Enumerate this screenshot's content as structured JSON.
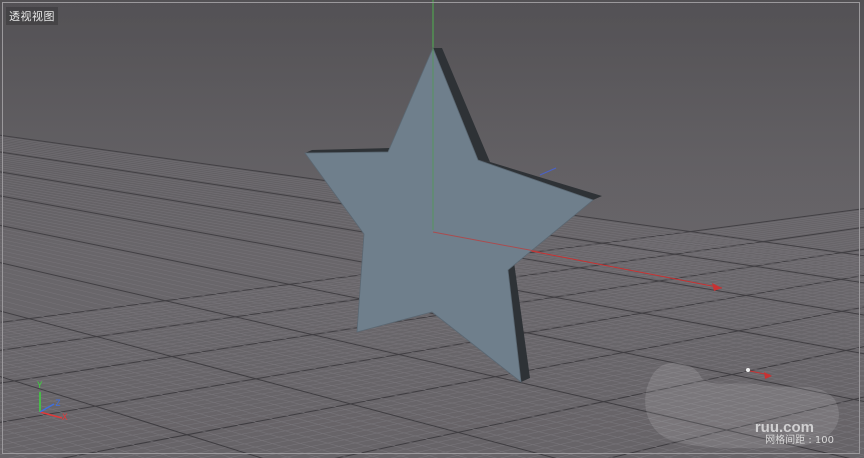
{
  "viewport": {
    "view_name": "透视视图",
    "grid_spacing": "网格间距 : 100",
    "watermark": "ruu.com"
  },
  "axes_gizmo": {
    "y_label": "Y",
    "z_label": "Z",
    "x_label": "X",
    "y_color": "#3fd43f",
    "z_color": "#3f6fe0",
    "x_color": "#e03a3a"
  },
  "colors": {
    "star_face": "#6f7f8c",
    "star_side": "#2e3236",
    "grid_line": "#777479",
    "grid_major": "#3e3c40",
    "axis_y": "#4fb14f",
    "axis_x": "#c83232",
    "axis_z": "#4a62c8"
  },
  "icons": {
    "view_axes": "axes-gizmo-icon"
  }
}
